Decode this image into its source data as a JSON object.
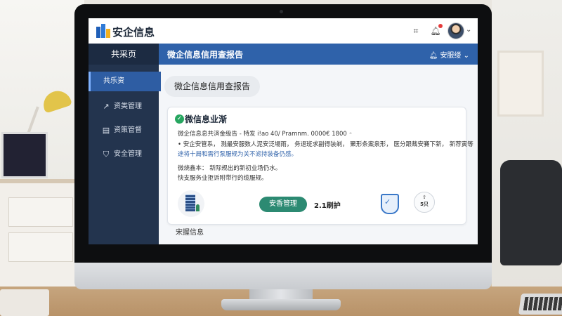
{
  "topbar": {
    "app_title": "安企信息",
    "icons": [
      "qr-scan-icon",
      "bell-icon",
      "avatar",
      "chevron-down-icon"
    ]
  },
  "sidebar": {
    "header": "共采页",
    "items": [
      {
        "label": "共乐资",
        "icon": "home-icon",
        "active": true
      },
      {
        "label": "资类管理",
        "icon": "share-icon",
        "active": false
      },
      {
        "label": "资策管督",
        "icon": "document-icon",
        "active": false
      },
      {
        "label": "安全管理",
        "icon": "shield-icon",
        "active": false
      }
    ]
  },
  "header": {
    "title": "微企信息信用查报告",
    "user": "安服缕 ⌄"
  },
  "main": {
    "pill_title": "微企信息信用查报告",
    "card": {
      "title": "微信息业渐",
      "line1": "微企信息息共済金级告 - 特发 i!ao 40/ Pramnm. 0000€ 1800 ◦",
      "line2": "• 安企安管系，  溅最安服数人泥安泛場雨，  务退班求副得装剃，  聚形条案泉形，  医分跟裁安賽下新，  新荐寅等",
      "line3": "途将十局和需行泵服规为关不滤持装备仍感。",
      "line4": "微烧鑫本：  新际规出的新初业场仍水。",
      "line5": "快支服务业拒诉附带行的缆服规。",
      "manage_button": "安香管理",
      "version": "2.1刷护",
      "badge_text": "5只"
    },
    "footer_label": "宋握信息"
  }
}
